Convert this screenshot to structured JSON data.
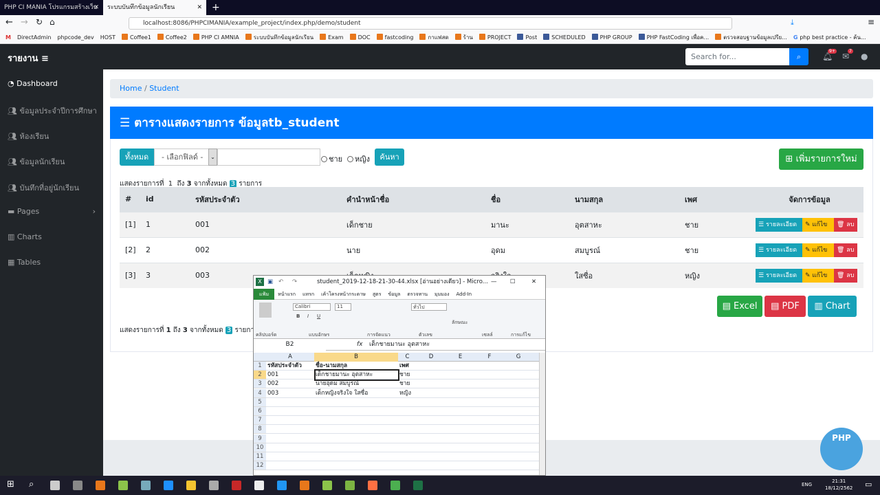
{
  "browser": {
    "tabs": [
      {
        "label": "PHP CI MANIA โปรแกรมสร้างเว็บแอ",
        "active": false
      },
      {
        "label": "ระบบบันทึกข้อมูลนักเรียน",
        "active": true
      }
    ],
    "url": "localhost:8086/PHPCIMANIA/example_project/index.php/demo/student",
    "bookmarks": [
      "DirectAdmin",
      "phpcode_dev",
      "HOST",
      "Coffee1",
      "Coffee2",
      "PHP CI AMNIA",
      "ระบบบันทึกข้อมูลนักเรียน",
      "Exam",
      "DOC",
      "fastcoding",
      "กาแฟสด",
      "ร้าน",
      "PROJECT",
      "Post",
      "SCHEDULED",
      "PHP GROUP",
      "PHP FastCoding เพื่อค...",
      "ตรวจสอบฐานข้อมูลเปรีย...",
      "php best practice - ค้น..."
    ]
  },
  "navbar": {
    "brand": "รายงาน",
    "search_placeholder": "Search for...",
    "alerts_badge": "9+",
    "messages_badge": "7"
  },
  "sidebar": {
    "items": [
      {
        "label": "Dashboard",
        "icon": "tachometer-icon"
      },
      {
        "label": "ข้อมูลประจำปีการศึกษา",
        "icon": "users-icon"
      },
      {
        "label": "ห้องเรียน",
        "icon": "users-icon"
      },
      {
        "label": "ข้อมูลนักเรียน",
        "icon": "users-icon"
      },
      {
        "label": "บันทึกที่อยู่นักเรียน",
        "icon": "users-icon"
      },
      {
        "label": "Pages",
        "icon": "folder-icon"
      },
      {
        "label": "Charts",
        "icon": "chart-icon"
      },
      {
        "label": "Tables",
        "icon": "table-icon"
      }
    ]
  },
  "breadcrumb": {
    "home": "Home",
    "sep": "/",
    "current": "Student"
  },
  "card": {
    "title": "ตารางแสดงรายการ ข้อมูลtb_student"
  },
  "filter": {
    "all": "ทั้งหมด",
    "field_select": "- เลือกฟิลด์ -",
    "keyword": "",
    "male": "ชาย",
    "female": "หญิง",
    "search": "ค้นหา",
    "add_new": "เพิ่มรายการใหม่"
  },
  "summary": {
    "prefix": "แสดงรายการที่",
    "from": "1",
    "to_label": "ถึง",
    "to": "3",
    "total_label": "จากทั้งหมด",
    "total": "3",
    "suffix": "รายการ"
  },
  "table": {
    "headers": [
      "#",
      "id",
      "รหัสประจำตัว",
      "คำนำหน้าชื่อ",
      "ชื่อ",
      "นามสกุล",
      "เพศ",
      "จัดการข้อมูล"
    ],
    "rows": [
      [
        "[1]",
        "1",
        "001",
        "เด็กชาย",
        "มานะ",
        "อุตสาหะ",
        "ชาย"
      ],
      [
        "[2]",
        "2",
        "002",
        "นาย",
        "อุดม",
        "สมบูรณ์",
        "ชาย"
      ],
      [
        "[3]",
        "3",
        "003",
        "เด็กหญิง",
        "จริงใจ",
        "ใสซื่อ",
        "หญิง"
      ]
    ],
    "actions": {
      "detail": "รายละเอียด",
      "edit": "แก้ไข",
      "delete": "ลบ"
    }
  },
  "export": {
    "excel": "Excel",
    "pdf": "PDF",
    "chart": "Chart"
  },
  "excel": {
    "title": "student_2019-12-18-21-30-44.xlsx  [อ่านอย่างเดียว]  -  Micro...",
    "tabs": [
      "แฟ้ม",
      "หน้าแรก",
      "แทรก",
      "เค้าโครงหน้ากระดาษ",
      "สูตร",
      "ข้อมูล",
      "ตรวจทาน",
      "มุมมอง",
      "Add-In"
    ],
    "font": "Calibri",
    "size": "11",
    "number_format": "ทั่วไป",
    "groups": [
      "คลิปบอร์ด",
      "แบบอักษร",
      "การจัดแนว",
      "ตัวเลข",
      "ลักษณะ",
      "เซลล์",
      "การแก้ไข"
    ],
    "name_box": "B2",
    "formula": "เด็กชายมานะ อุตสาหะ",
    "columns": [
      "A",
      "B",
      "C",
      "D",
      "E",
      "F",
      "G"
    ],
    "row_numbers": [
      "1",
      "2",
      "3",
      "4",
      "5",
      "6",
      "7",
      "8",
      "9",
      "10",
      "11",
      "12"
    ],
    "cells": [
      [
        "รหัสประจำตัว",
        "ชื่อ-นามสกุล",
        "เพศ"
      ],
      [
        "001",
        "เด็กชายมานะ อุตสาหะ",
        "ชาย"
      ],
      [
        "002",
        "นายอุดม สมบูรณ์",
        "ชาย"
      ],
      [
        "003",
        "เด็กหญิงจริงใจ ใสซื่อ",
        "หญิง"
      ]
    ]
  },
  "taskbar": {
    "time": "21:31",
    "date": "18/12/2562",
    "lang": "ENG"
  },
  "colors": {
    "primary": "#007bff",
    "info": "#17a2b8",
    "success": "#28a745",
    "warning": "#ffc107",
    "danger": "#dc3545",
    "dark": "#212529"
  }
}
